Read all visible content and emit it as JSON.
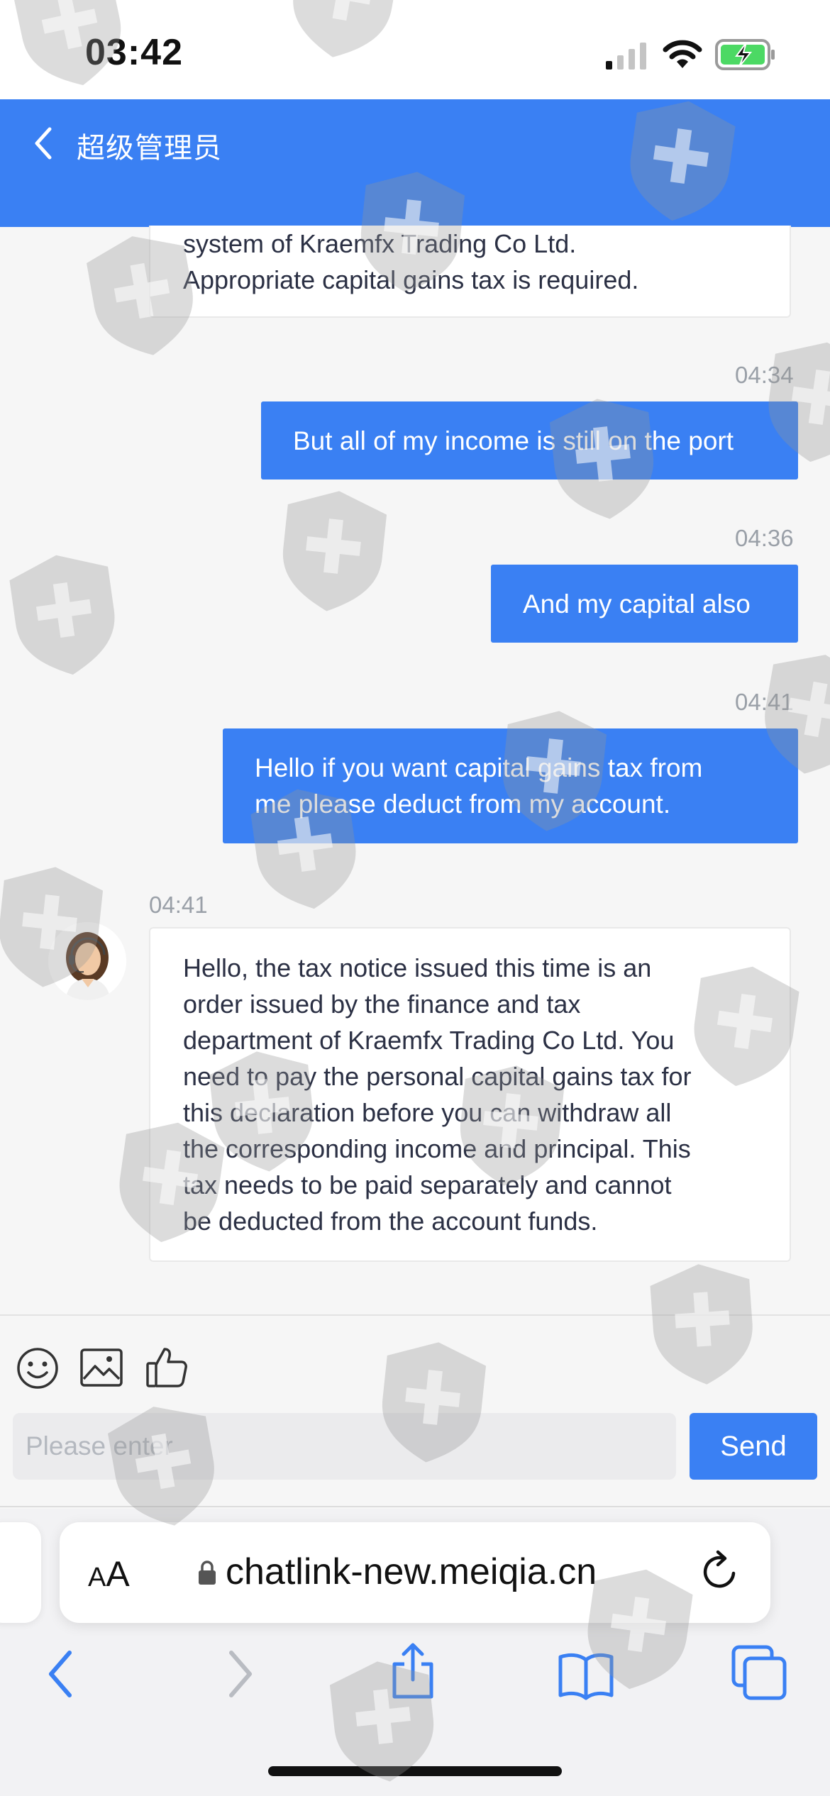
{
  "status_bar": {
    "time": "03:42",
    "icons": [
      "signal-icon",
      "wifi-icon",
      "battery-charging-icon"
    ]
  },
  "header": {
    "back_icon": "chevron-left-icon",
    "title": "超级管理员",
    "color": "#3a80f3"
  },
  "messages": [
    {
      "direction": "incoming",
      "time": "",
      "lines": [
        "system of Kraemfx Trading Co Ltd.",
        "Appropriate capital gains tax is required."
      ]
    },
    {
      "direction": "outgoing",
      "time": "04:34",
      "lines": [
        "But all of my income is still on the port"
      ]
    },
    {
      "direction": "outgoing",
      "time": "04:36",
      "lines": [
        "And my capital also"
      ]
    },
    {
      "direction": "outgoing",
      "time": "04:41",
      "lines": [
        "Hello if you want capital gains tax from",
        "me please deduct from my account."
      ]
    },
    {
      "direction": "incoming",
      "time": "04:41",
      "avatar": "agent-avatar",
      "lines": [
        "Hello, the tax notice issued this time is an",
        "order issued by the finance and tax",
        "department of Kraemfx Trading Co Ltd. You",
        "need to pay the personal capital gains tax for",
        "this declaration before you can withdraw all",
        "the corresponding income and principal. This",
        "tax needs to be paid separately and cannot",
        "be deducted from the account funds."
      ]
    }
  ],
  "composer": {
    "tools": [
      "emoji-icon",
      "image-icon",
      "thumbs-up-icon"
    ],
    "input_value": "",
    "placeholder": "Please enter",
    "send_label": "Send"
  },
  "browser": {
    "text_size_small": "A",
    "text_size_large": "A",
    "url": "chatlink-new.meiqia.cn",
    "toolbar_icons": [
      "back-icon",
      "forward-icon",
      "share-icon",
      "bookmarks-icon",
      "tabs-icon"
    ],
    "accent": "#3a80f3"
  }
}
